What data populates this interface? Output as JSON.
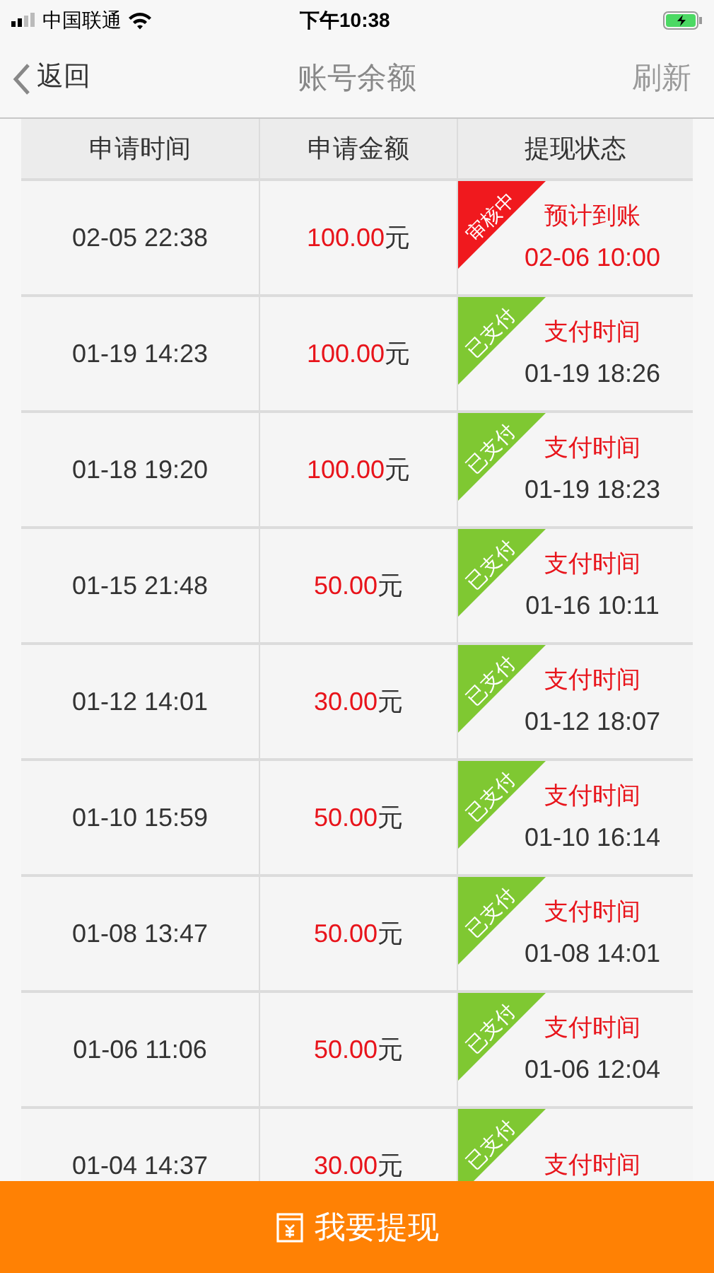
{
  "status_bar": {
    "carrier": "中国联通",
    "time": "下午10:38"
  },
  "nav": {
    "back": "返回",
    "title": "账号余额",
    "action": "刷新"
  },
  "table": {
    "columns": [
      "申请时间",
      "申请金额",
      "提现状态"
    ],
    "rows": [
      {
        "time": "02-05 22:38",
        "amount": "100.00",
        "unit": "元",
        "status": {
          "kind": "reviewing",
          "tag": "审核中",
          "label": "预计到账",
          "time": "02-06 10:00"
        }
      },
      {
        "time": "01-19 14:23",
        "amount": "100.00",
        "unit": "元",
        "status": {
          "kind": "paid",
          "tag": "已支付",
          "label": "支付时间",
          "time": "01-19 18:26"
        }
      },
      {
        "time": "01-18 19:20",
        "amount": "100.00",
        "unit": "元",
        "status": {
          "kind": "paid",
          "tag": "已支付",
          "label": "支付时间",
          "time": "01-19 18:23"
        }
      },
      {
        "time": "01-15 21:48",
        "amount": "50.00",
        "unit": "元",
        "status": {
          "kind": "paid",
          "tag": "已支付",
          "label": "支付时间",
          "time": "01-16 10:11"
        }
      },
      {
        "time": "01-12 14:01",
        "amount": "30.00",
        "unit": "元",
        "status": {
          "kind": "paid",
          "tag": "已支付",
          "label": "支付时间",
          "time": "01-12 18:07"
        }
      },
      {
        "time": "01-10 15:59",
        "amount": "50.00",
        "unit": "元",
        "status": {
          "kind": "paid",
          "tag": "已支付",
          "label": "支付时间",
          "time": "01-10 16:14"
        }
      },
      {
        "time": "01-08 13:47",
        "amount": "50.00",
        "unit": "元",
        "status": {
          "kind": "paid",
          "tag": "已支付",
          "label": "支付时间",
          "time": "01-08 14:01"
        }
      },
      {
        "time": "01-06 11:06",
        "amount": "50.00",
        "unit": "元",
        "status": {
          "kind": "paid",
          "tag": "已支付",
          "label": "支付时间",
          "time": "01-06 12:04"
        }
      },
      {
        "time": "01-04 14:37",
        "amount": "30.00",
        "unit": "元",
        "status": {
          "kind": "paid",
          "tag": "已支付",
          "label": "支付时间"
        }
      }
    ]
  },
  "withdraw_button": "我要提现"
}
